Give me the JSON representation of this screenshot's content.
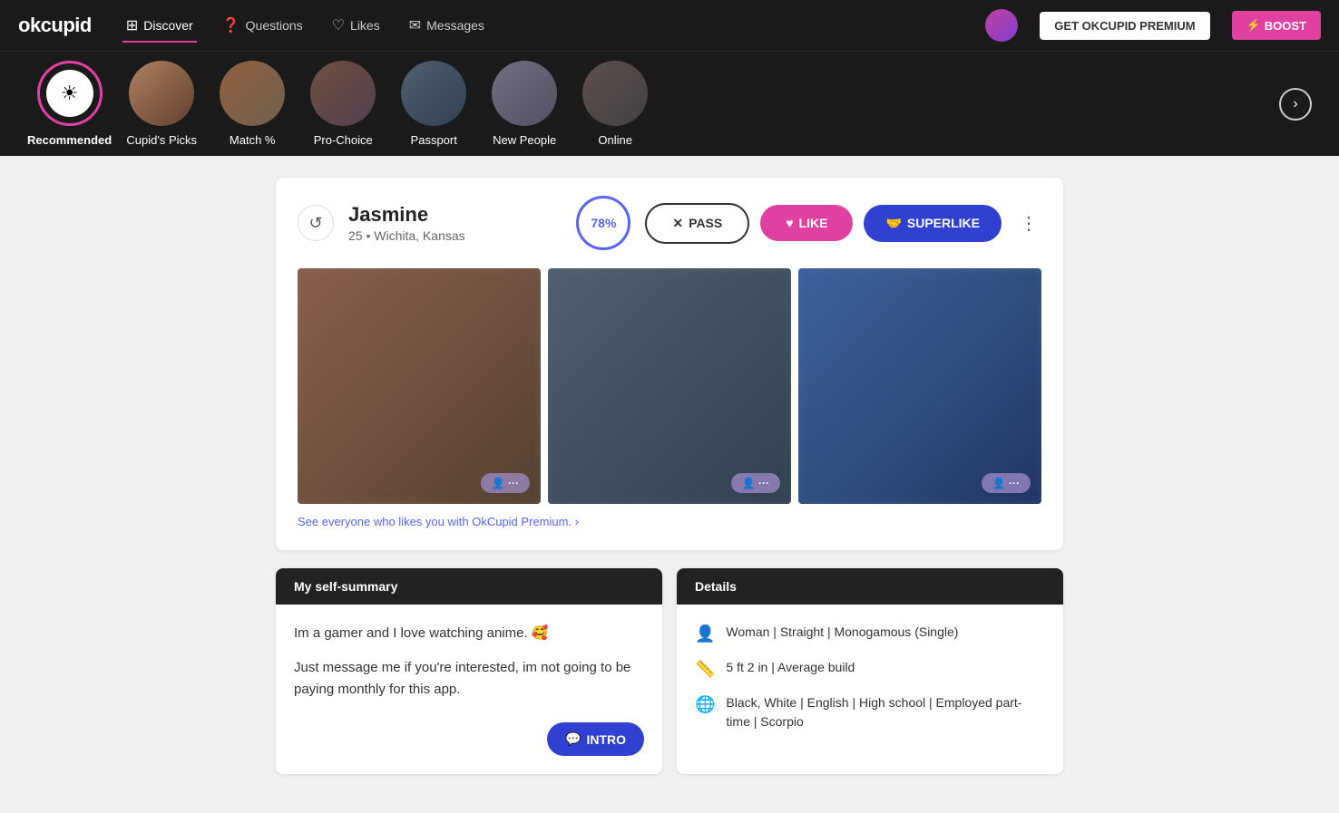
{
  "logo": "okcupid",
  "nav": {
    "items": [
      {
        "label": "Discover",
        "icon": "⊞",
        "active": true
      },
      {
        "label": "Questions",
        "icon": "?"
      },
      {
        "label": "Likes",
        "icon": "♡"
      },
      {
        "label": "Messages",
        "icon": "✉"
      }
    ],
    "premium_btn": "GET OKCUPID PREMIUM",
    "boost_btn": "⚡ BOOST"
  },
  "discover": {
    "items": [
      {
        "label": "Recommended",
        "type": "recommended",
        "active": true
      },
      {
        "label": "Cupid's Picks",
        "type": "photo",
        "color": "color1"
      },
      {
        "label": "Match %",
        "type": "photo",
        "color": "color2"
      },
      {
        "label": "Pro-Choice",
        "type": "photo",
        "color": "color3"
      },
      {
        "label": "Passport",
        "type": "photo",
        "color": "color4"
      },
      {
        "label": "New People",
        "type": "photo",
        "color": "color5"
      },
      {
        "label": "Online",
        "type": "photo",
        "color": "color6"
      }
    ],
    "next_btn": "›"
  },
  "profile": {
    "name": "Jasmine",
    "age": "25",
    "location": "Wichita, Kansas",
    "match_pct": "78%",
    "pass_btn": "PASS",
    "like_btn": "LIKE",
    "superlike_btn": "SUPERLIKE",
    "photos": [
      {
        "badge": ""
      },
      {
        "badge": ""
      },
      {
        "badge": ""
      }
    ],
    "premium_link": "See everyone who likes you with OkCupid Premium. ›"
  },
  "self_summary": {
    "header": "My self-summary",
    "text1": "Im a gamer and I love watching anime. 🥰",
    "text2": "Just message me if you're interested, im not going to be paying monthly for this app.",
    "intro_btn": "INTRO"
  },
  "details": {
    "header": "Details",
    "rows": [
      {
        "icon": "👤",
        "text": "Woman | Straight | Monogamous (Single)"
      },
      {
        "icon": "📏",
        "text": "5 ft 2 in | Average build"
      },
      {
        "icon": "🌐",
        "text": "Black, White | English | High school | Employed part-time | Scorpio"
      }
    ]
  }
}
